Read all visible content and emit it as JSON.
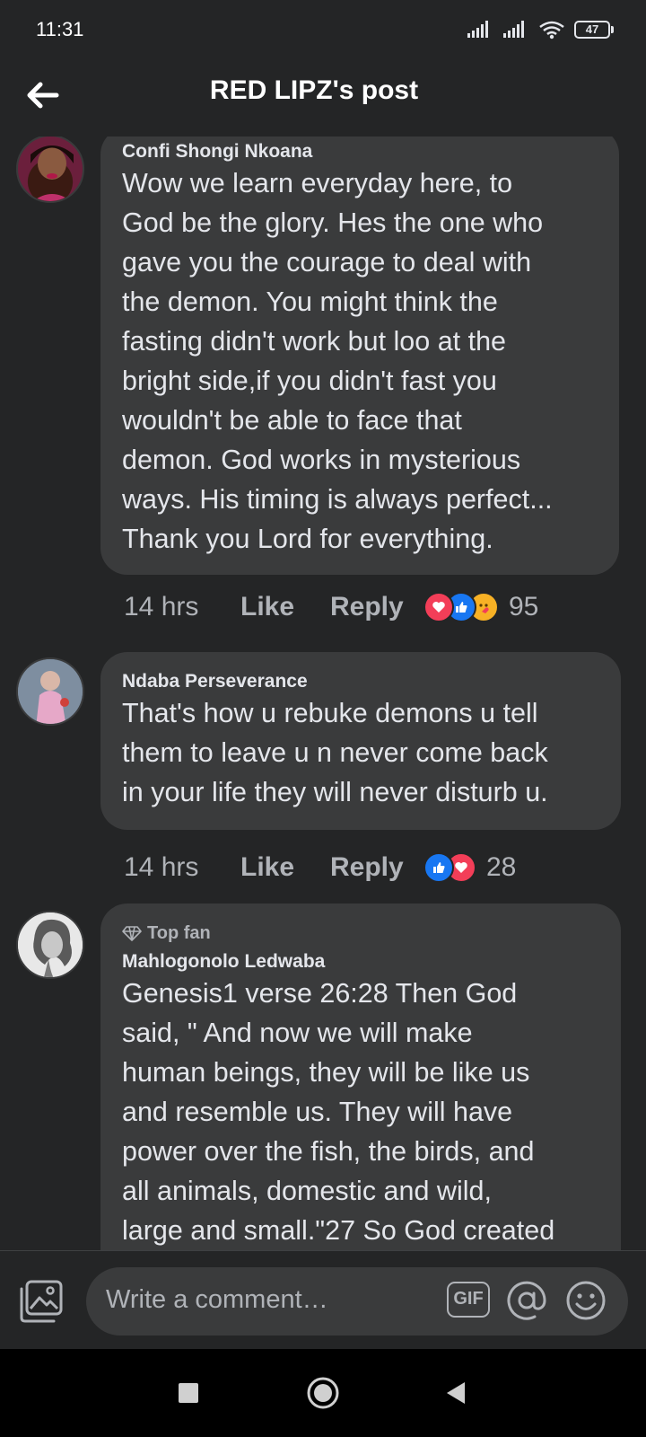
{
  "status_bar": {
    "time": "11:31",
    "battery": "47"
  },
  "header": {
    "title": "RED LIPZ's post"
  },
  "comments": [
    {
      "author": "Confi Shongi Nkoana",
      "text": "Wow we learn everyday here, to\nGod be the glory. Hes the one who\ngave you the courage to deal with\nthe demon. You might think the\nfasting didn't work but loo at the\nbright side,if you didn't fast you\nwouldn't be able to face that\ndemon. God works in mysterious\nways. His timing is always perfect...\nThank you Lord for everything.",
      "time": "14 hrs",
      "like_label": "Like",
      "reply_label": "Reply",
      "reactions": [
        "love",
        "like",
        "care"
      ],
      "reaction_count": "95"
    },
    {
      "author": "Ndaba Perseverance",
      "text": "That's how u rebuke demons u tell\nthem to leave u n never come back\nin your life they will never disturb u.",
      "time": "14 hrs",
      "like_label": "Like",
      "reply_label": "Reply",
      "reactions": [
        "like",
        "love"
      ],
      "reaction_count": "28"
    },
    {
      "badge": "Top fan",
      "author": "Mahlogonolo Ledwaba",
      "text": "Genesis1 verse 26:28 Then God\nsaid, \" And now we will make\nhuman beings, they will be like us\nand resemble us. They will have\npower over the fish, the birds, and\nall animals, domestic and wild,\nlarge and small.\"27 So God created"
    }
  ],
  "composer": {
    "placeholder": "Write a comment…",
    "gif_label": "GIF"
  },
  "colors": {
    "background": "#242526",
    "bubble": "#3a3b3c",
    "text": "#e4e6eb",
    "muted": "#b0b3b8",
    "like_blue": "#1877f2",
    "love_red": "#f33e58",
    "care_yellow": "#f7b125"
  },
  "icons": {
    "back": "arrow-left-icon",
    "photo": "image-icon",
    "mention": "at-sign-icon",
    "emoji": "smiley-icon",
    "nav": [
      "square-recents-icon",
      "circle-home-icon",
      "triangle-back-icon"
    ]
  }
}
